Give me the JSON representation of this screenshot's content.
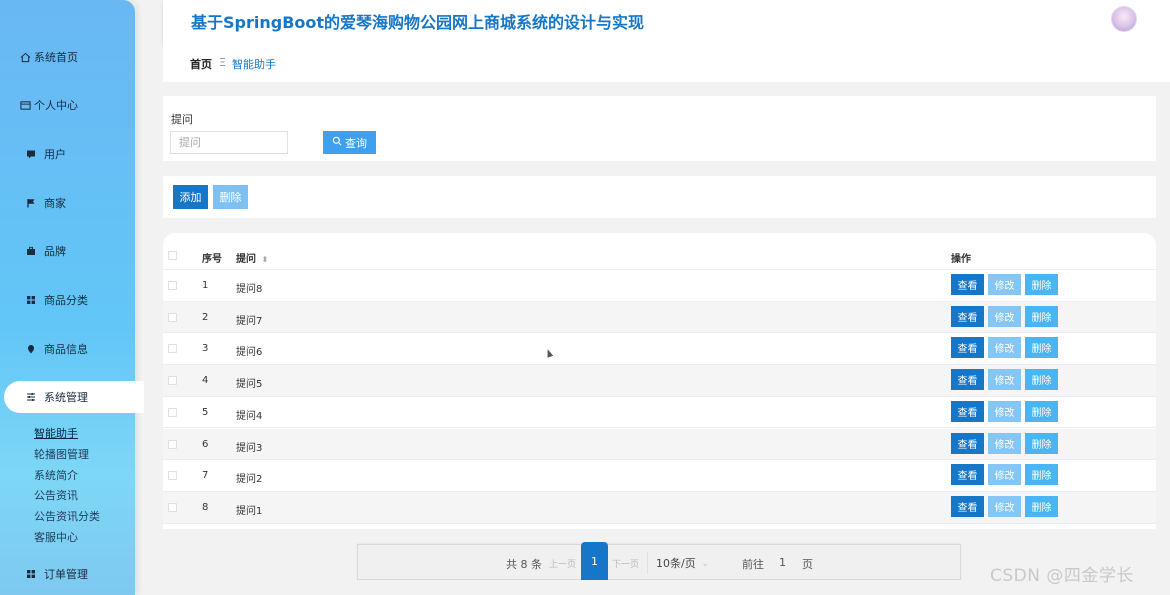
{
  "header": {
    "title": "基于SpringBoot的爱琴海购物公园网上商城系统的设计与实现"
  },
  "breadcrumb": {
    "home": "首页",
    "separator": "Ξ",
    "current": "智能助手"
  },
  "sidebar": {
    "items": [
      {
        "label": "系统首页",
        "icon": "home-icon"
      },
      {
        "label": "个人中心",
        "icon": "card-icon"
      },
      {
        "label": "用户",
        "icon": "chat-icon"
      },
      {
        "label": "商家",
        "icon": "flag-icon"
      },
      {
        "label": "品牌",
        "icon": "briefcase-icon"
      },
      {
        "label": "商品分类",
        "icon": "grid-icon"
      },
      {
        "label": "商品信息",
        "icon": "pin-icon"
      },
      {
        "label": "系统管理",
        "icon": "sliders-icon"
      },
      {
        "label": "订单管理",
        "icon": "grid-icon"
      }
    ],
    "submenu": [
      "智能助手",
      "轮播图管理",
      "系统简介",
      "公告资讯",
      "公告资讯分类",
      "客服中心"
    ]
  },
  "search": {
    "label": "提问",
    "placeholder": "提问",
    "button": "查询"
  },
  "actions": {
    "add": "添加",
    "delete": "删除"
  },
  "table": {
    "headers": {
      "index": "序号",
      "question": "提问",
      "ops": "操作"
    },
    "op_labels": {
      "view": "查看",
      "edit": "修改",
      "delete": "删除"
    },
    "rows": [
      {
        "index": "1",
        "question": "提问8"
      },
      {
        "index": "2",
        "question": "提问7"
      },
      {
        "index": "3",
        "question": "提问6"
      },
      {
        "index": "4",
        "question": "提问5"
      },
      {
        "index": "5",
        "question": "提问4"
      },
      {
        "index": "6",
        "question": "提问3"
      },
      {
        "index": "7",
        "question": "提问2"
      },
      {
        "index": "8",
        "question": "提问1"
      }
    ]
  },
  "pagination": {
    "total": "共 8 条",
    "prev": "上一页",
    "page": "1",
    "next": "下一页",
    "page_size": "10条/页",
    "goto": "前往",
    "goto_value": "1",
    "page_unit": "页"
  },
  "watermark": "CSDN @四金学长",
  "colors": {
    "primary": "#1677c8",
    "sidebar": "#69b8f4",
    "light_button": "#85c6f5"
  }
}
